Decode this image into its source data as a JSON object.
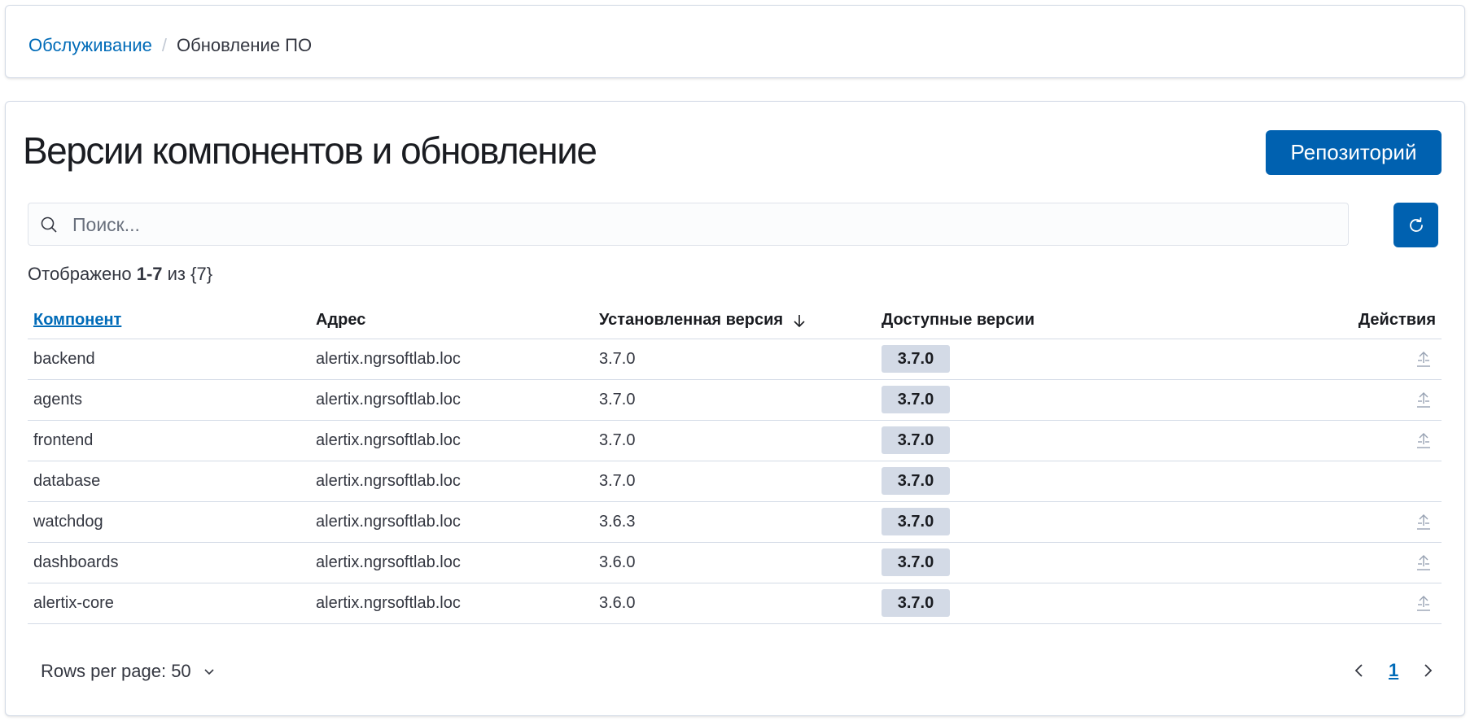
{
  "breadcrumbs": {
    "parent": "Обслуживание",
    "separator": "/",
    "current": "Обновление ПО"
  },
  "header": {
    "title": "Версии компонентов и обновление",
    "repo_button": "Репозиторий"
  },
  "search": {
    "placeholder": "Поиск...",
    "value": ""
  },
  "count": {
    "prefix": "Отображено",
    "range": "1-7",
    "middle": "из",
    "total": "{7}"
  },
  "table": {
    "columns": {
      "component": "Компонент",
      "address": "Адрес",
      "installed": "Установленная версия",
      "available": "Доступные версии",
      "actions": "Действия"
    },
    "rows": [
      {
        "component": "backend",
        "address": "alertix.ngrsoftlab.loc",
        "installed": "3.7.0",
        "available": "3.7.0",
        "has_action": true
      },
      {
        "component": "agents",
        "address": "alertix.ngrsoftlab.loc",
        "installed": "3.7.0",
        "available": "3.7.0",
        "has_action": true
      },
      {
        "component": "frontend",
        "address": "alertix.ngrsoftlab.loc",
        "installed": "3.7.0",
        "available": "3.7.0",
        "has_action": true
      },
      {
        "component": "database",
        "address": "alertix.ngrsoftlab.loc",
        "installed": "3.7.0",
        "available": "3.7.0",
        "has_action": false
      },
      {
        "component": "watchdog",
        "address": "alertix.ngrsoftlab.loc",
        "installed": "3.6.3",
        "available": "3.7.0",
        "has_action": true
      },
      {
        "component": "dashboards",
        "address": "alertix.ngrsoftlab.loc",
        "installed": "3.6.0",
        "available": "3.7.0",
        "has_action": true
      },
      {
        "component": "alertix-core",
        "address": "alertix.ngrsoftlab.loc",
        "installed": "3.6.0",
        "available": "3.7.0",
        "has_action": true
      }
    ]
  },
  "footer": {
    "rows_per_page": "Rows per page: 50",
    "current_page": "1"
  },
  "colors": {
    "primary": "#0061b0",
    "link": "#006bb8",
    "badge": "#d3dae6"
  }
}
